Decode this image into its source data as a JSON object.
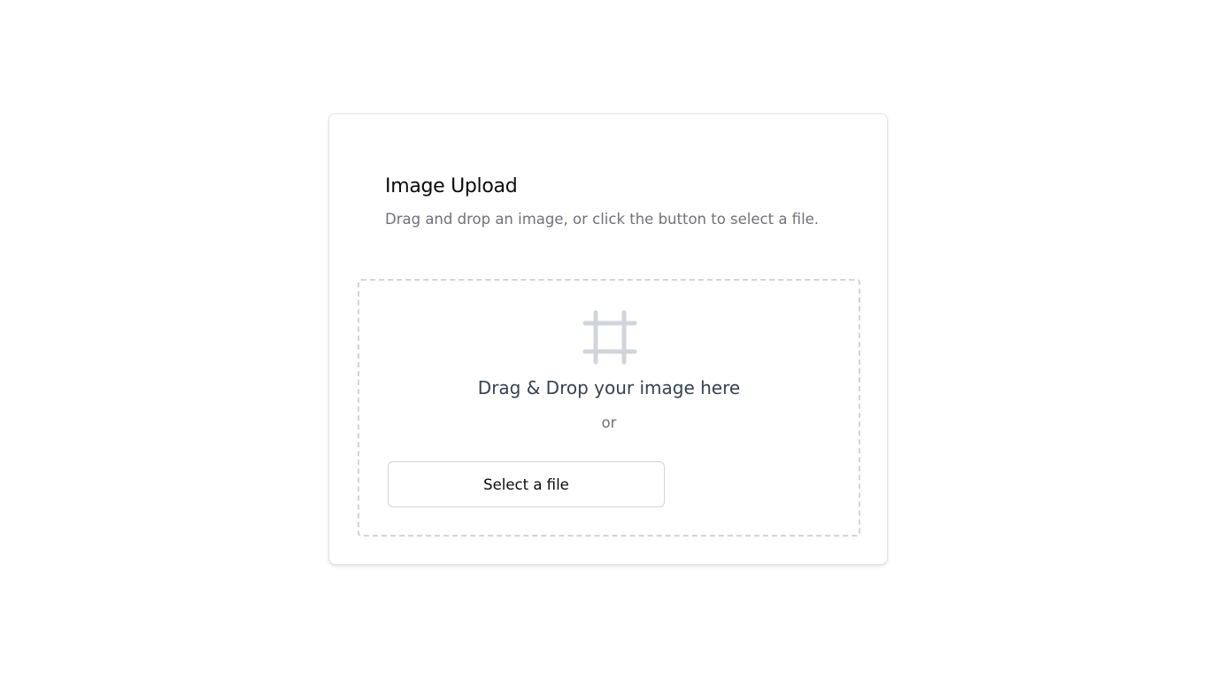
{
  "card": {
    "title": "Image Upload",
    "subtitle": "Drag and drop an image, or click the button to select a file."
  },
  "dropzone": {
    "icon": "frame-icon",
    "primary_text": "Drag & Drop your image here",
    "separator_text": "or",
    "button_label": "Select a file"
  },
  "colors": {
    "title": "#0a0a0a",
    "muted_text": "#71717a",
    "drop_text": "#374151",
    "icon": "#d1d5db",
    "border": "#e4e4e7",
    "dashed_border": "#d4d4d8"
  }
}
